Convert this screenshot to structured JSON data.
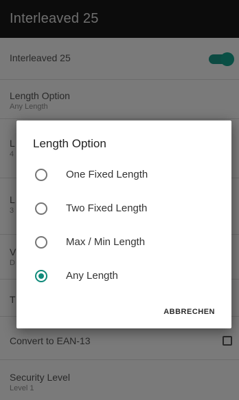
{
  "app_bar": {
    "title": "Interleaved 25"
  },
  "settings": {
    "rows": [
      {
        "title": "Interleaved 25",
        "subtitle": ""
      },
      {
        "title": "Length Option",
        "subtitle": "Any Length"
      },
      {
        "title": "L",
        "subtitle": "4"
      },
      {
        "title": "L",
        "subtitle": "3"
      },
      {
        "title": "V",
        "subtitle": "D"
      },
      {
        "title": "T",
        "subtitle": ""
      },
      {
        "title": "Convert to EAN-13",
        "subtitle": ""
      },
      {
        "title": "Security Level",
        "subtitle": "Level 1"
      }
    ],
    "interleaved_switch_on": true,
    "convert_checked": false
  },
  "dialog": {
    "title": "Length Option",
    "options": [
      {
        "label": "One Fixed Length",
        "selected": false
      },
      {
        "label": "Two Fixed Length",
        "selected": false
      },
      {
        "label": "Max / Min Length",
        "selected": false
      },
      {
        "label": "Any Length",
        "selected": true
      }
    ],
    "cancel_label": "ABBRECHEN"
  },
  "colors": {
    "accent": "#0f8a7a",
    "scrim_bg": "#7a7a7a",
    "titlebar_bg": "#0c0c0c"
  }
}
